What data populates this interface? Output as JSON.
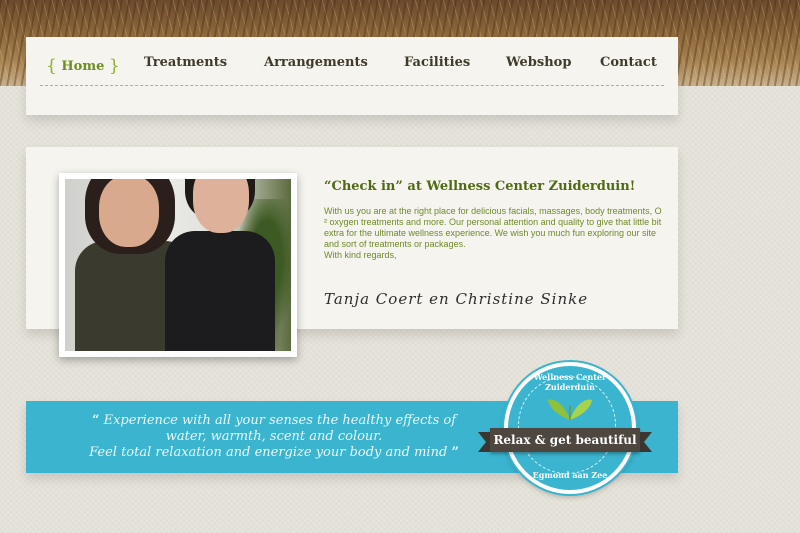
{
  "nav": {
    "items": [
      {
        "label": "Home",
        "active": true
      },
      {
        "label": "Treatments"
      },
      {
        "label": "Arrangements"
      },
      {
        "label": "Facilities"
      },
      {
        "label": "Webshop"
      },
      {
        "label": "Contact"
      }
    ],
    "brace_open": "{",
    "brace_close": "}"
  },
  "intro": {
    "title": "“Check in” at Wellness Center Zuiderduin!",
    "body": "With us you are at the right place for delicious facials, massages, body treatments, O ² oxygen treatments and more. Our personal attention and quality to give that little bit extra for the ultimate wellness experience. We wish you much fun exploring our site and sort of treatments or packages.",
    "closing": "With kind regards,",
    "signature": "Tanja Coert en Christine Sinke"
  },
  "banner": {
    "open_quote": "“",
    "close_quote": "”",
    "lines": [
      "Experience with all your senses the healthy effects of",
      "water, warmth, scent and colour.",
      "Feel total relaxation and energize your body and mind"
    ]
  },
  "badge": {
    "top_text": "Wellness Center Zuiderduin",
    "ribbon_text": "Relax & get beautiful",
    "bottom_text": "Egmond aan Zee"
  },
  "colors": {
    "accent_green": "#6e8f1e",
    "banner_blue": "#3bb4cf"
  }
}
